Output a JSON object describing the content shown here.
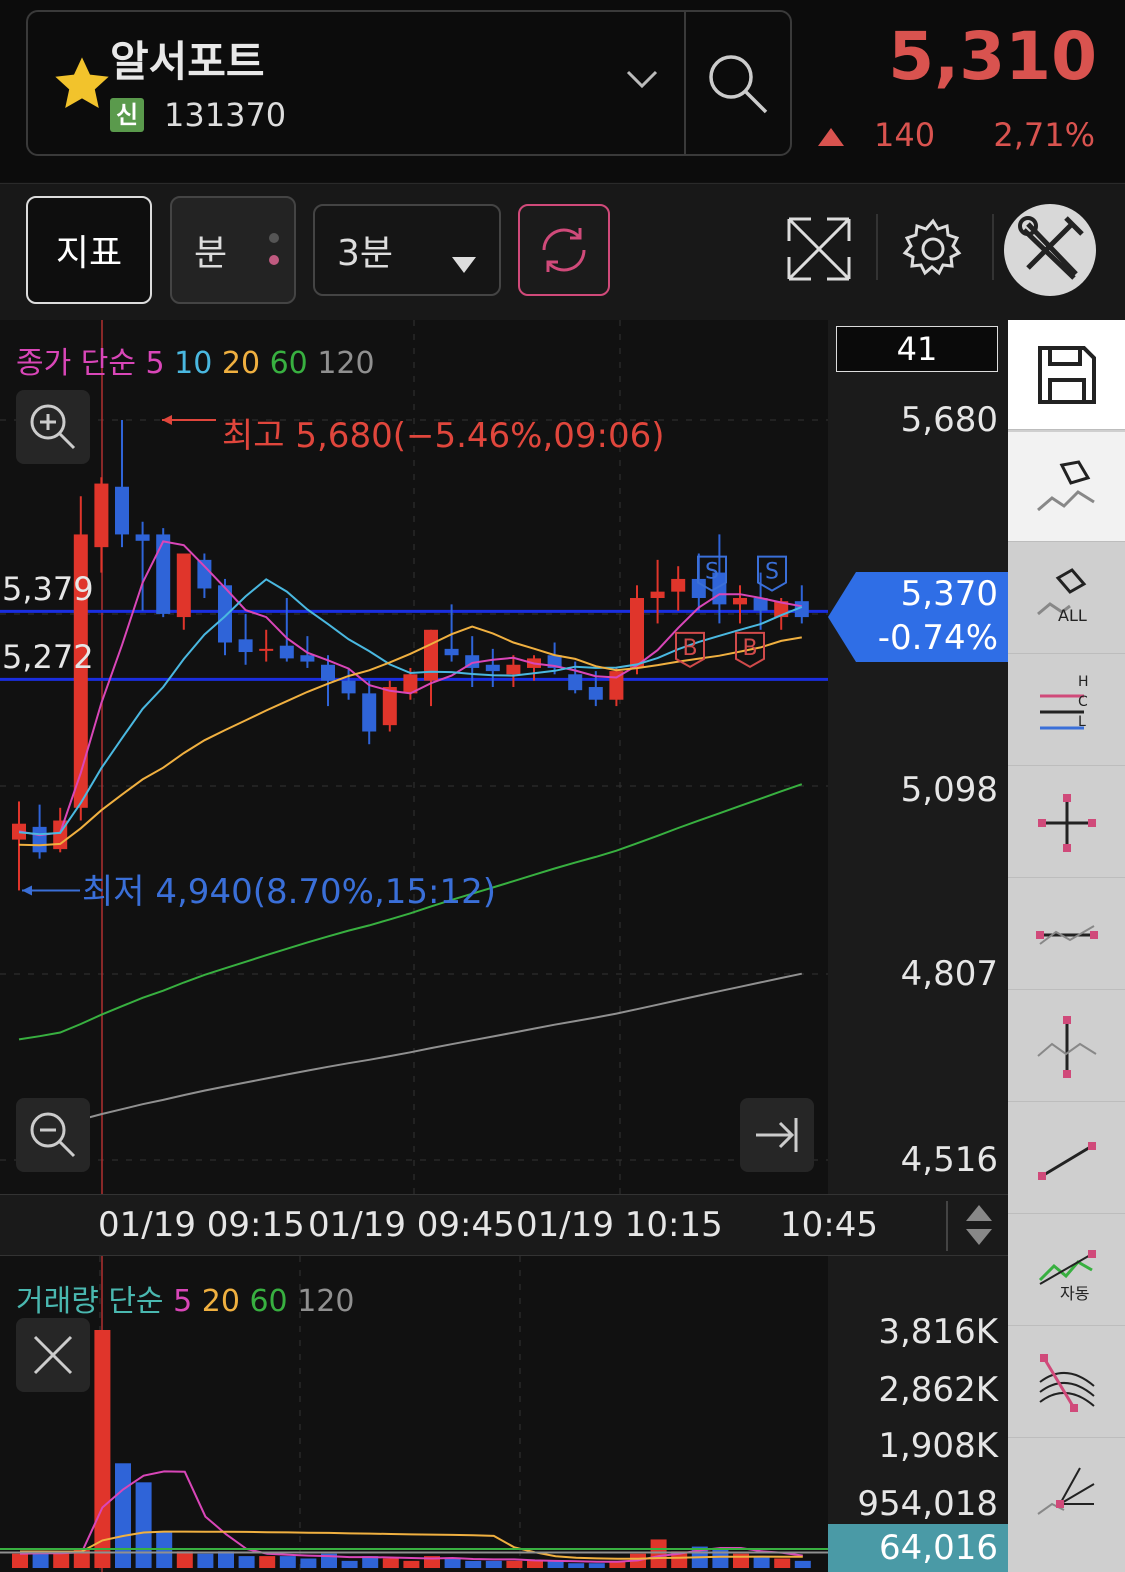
{
  "header": {
    "stock_name": "알서포트",
    "badge": "신",
    "code": "131370",
    "price": "5,310",
    "change": "140",
    "change_pct": "2,71%"
  },
  "toolbar": {
    "indicator_label": "지표",
    "minute_label": "분",
    "period_label": "3분"
  },
  "price_chart": {
    "legend_prefix": "종가 단순",
    "ma_labels": [
      "5",
      "10",
      "20",
      "60",
      "120"
    ],
    "ma_colors": [
      "#d946b8",
      "#4ab8e0",
      "#f0b040",
      "#38b040",
      "#909090"
    ],
    "count_box": "41",
    "axis_labels": [
      "5,680",
      "5,098",
      "4,807",
      "4,516"
    ],
    "left_labels": [
      "5,379",
      "5,272"
    ],
    "current_price": "5,370",
    "current_pct": "-0.74%",
    "high_annotation": "최고 5,680(−5.46%,09:06)",
    "low_annotation": "최저 4,940(8.70%,15:12)"
  },
  "time_axis": [
    "01/19 09:15",
    "01/19 09:45",
    "01/19 10:15",
    "10:45"
  ],
  "volume_chart": {
    "legend_prefix": "거래량 단순",
    "ma_labels": [
      "5",
      "20",
      "60",
      "120"
    ],
    "axis_labels": [
      "3,816K",
      "2,862K",
      "1,908K",
      "954,018"
    ],
    "current_volume": "64,016"
  },
  "tools": [
    "save",
    "eraser",
    "eraser-all",
    "hcl-lines",
    "crosshair",
    "horizontal-line",
    "vertical-line",
    "trend-line",
    "auto-trend",
    "fibonacci-arc",
    "fan-line"
  ],
  "tool_labels": {
    "eraser_all": "ALL",
    "auto": "자동",
    "h": "H",
    "c": "C",
    "l": "L"
  },
  "chart_data": {
    "type": "candlestick",
    "price_range": [
      4516,
      5680
    ],
    "candles": [
      {
        "o": 5020,
        "h": 5080,
        "l": 4940,
        "c": 5045
      },
      {
        "o": 5040,
        "h": 5075,
        "l": 4990,
        "c": 5000
      },
      {
        "o": 5005,
        "h": 5070,
        "l": 5000,
        "c": 5050
      },
      {
        "o": 5070,
        "h": 5560,
        "l": 5050,
        "c": 5500
      },
      {
        "o": 5480,
        "h": 5590,
        "l": 5440,
        "c": 5580
      },
      {
        "o": 5575,
        "h": 5680,
        "l": 5480,
        "c": 5500
      },
      {
        "o": 5500,
        "h": 5520,
        "l": 5380,
        "c": 5490
      },
      {
        "o": 5500,
        "h": 5510,
        "l": 5370,
        "c": 5375
      },
      {
        "o": 5370,
        "h": 5470,
        "l": 5350,
        "c": 5470
      },
      {
        "o": 5460,
        "h": 5470,
        "l": 5400,
        "c": 5415
      },
      {
        "o": 5420,
        "h": 5430,
        "l": 5310,
        "c": 5330
      },
      {
        "o": 5335,
        "h": 5375,
        "l": 5295,
        "c": 5315
      },
      {
        "o": 5320,
        "h": 5350,
        "l": 5300,
        "c": 5320
      },
      {
        "o": 5325,
        "h": 5400,
        "l": 5300,
        "c": 5305
      },
      {
        "o": 5310,
        "h": 5340,
        "l": 5290,
        "c": 5300
      },
      {
        "o": 5295,
        "h": 5310,
        "l": 5230,
        "c": 5270
      },
      {
        "o": 5270,
        "h": 5290,
        "l": 5240,
        "c": 5250
      },
      {
        "o": 5250,
        "h": 5270,
        "l": 5170,
        "c": 5190
      },
      {
        "o": 5200,
        "h": 5270,
        "l": 5190,
        "c": 5260
      },
      {
        "o": 5250,
        "h": 5290,
        "l": 5240,
        "c": 5280
      },
      {
        "o": 5270,
        "h": 5350,
        "l": 5230,
        "c": 5350
      },
      {
        "o": 5320,
        "h": 5390,
        "l": 5300,
        "c": 5310
      },
      {
        "o": 5310,
        "h": 5340,
        "l": 5260,
        "c": 5290
      },
      {
        "o": 5295,
        "h": 5320,
        "l": 5260,
        "c": 5285
      },
      {
        "o": 5280,
        "h": 5310,
        "l": 5260,
        "c": 5295
      },
      {
        "o": 5290,
        "h": 5310,
        "l": 5270,
        "c": 5305
      },
      {
        "o": 5310,
        "h": 5330,
        "l": 5280,
        "c": 5290
      },
      {
        "o": 5280,
        "h": 5300,
        "l": 5250,
        "c": 5255
      },
      {
        "o": 5260,
        "h": 5285,
        "l": 5230,
        "c": 5240
      },
      {
        "o": 5240,
        "h": 5290,
        "l": 5230,
        "c": 5285
      },
      {
        "o": 5290,
        "h": 5420,
        "l": 5280,
        "c": 5400
      },
      {
        "o": 5400,
        "h": 5460,
        "l": 5360,
        "c": 5410
      },
      {
        "o": 5410,
        "h": 5450,
        "l": 5380,
        "c": 5430
      },
      {
        "o": 5430,
        "h": 5470,
        "l": 5380,
        "c": 5400
      },
      {
        "o": 5440,
        "h": 5500,
        "l": 5360,
        "c": 5390
      },
      {
        "o": 5390,
        "h": 5420,
        "l": 5360,
        "c": 5400
      },
      {
        "o": 5400,
        "h": 5440,
        "l": 5350,
        "c": 5380
      },
      {
        "o": 5370,
        "h": 5400,
        "l": 5350,
        "c": 5395
      },
      {
        "o": 5395,
        "h": 5420,
        "l": 5360,
        "c": 5370
      }
    ],
    "levels": [
      5379,
      5272
    ],
    "volume_range": [
      0,
      3816000
    ]
  }
}
